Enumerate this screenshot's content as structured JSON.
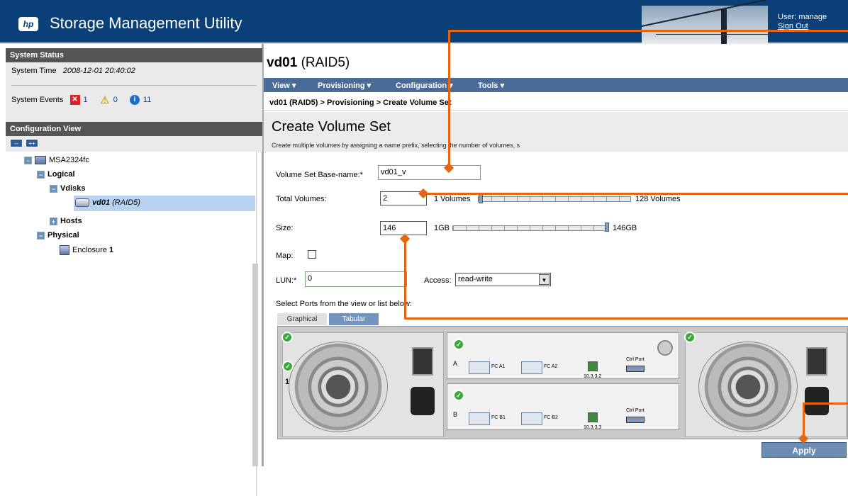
{
  "header": {
    "logo_text": "hp",
    "app_title": "Storage Management Utility",
    "user_label": "User: manage",
    "signout_label": "Sign Out"
  },
  "status": {
    "heading": "System Status",
    "time_label": "System Time",
    "time_value": "2008-12-01 20:40:02",
    "events_label": "System Events",
    "errors": "1",
    "warnings": "0",
    "info": "11"
  },
  "config": {
    "heading": "Configuration View",
    "collapse_label": "--",
    "expand_label": "++"
  },
  "tree": {
    "system": "MSA2324fc",
    "logical": "Logical",
    "vdisks": "Vdisks",
    "vdisk_name": "vd01",
    "vdisk_raid": "(RAID5)",
    "hosts": "Hosts",
    "physical": "Physical",
    "enclosure_label": "Enclosure",
    "enclosure_num": "1"
  },
  "main": {
    "title_name": "vd01",
    "title_raid": "(RAID5)",
    "menu": [
      "View ▾",
      "Provisioning ▾",
      "Configuration ▾",
      "Tools ▾"
    ],
    "breadcrumb": "vd01 (RAID5) > Provisioning > Create Volume Set",
    "page_title": "Create Volume Set",
    "description": "Create multiple volumes by assigning a name prefix, selecting the number of volumes, s",
    "form": {
      "basename_label": "Volume Set Base-name:*",
      "basename_value": "vd01_v",
      "total_label": "Total Volumes:",
      "total_value": "2",
      "total_min": "1 Volumes",
      "total_max": "128 Volumes",
      "size_label": "Size:",
      "size_value": "146",
      "size_min": "1GB",
      "size_max": "146GB",
      "map_label": "Map:",
      "lun_label": "LUN:*",
      "lun_value": "0",
      "access_label": "Access:",
      "access_value": "read-write",
      "ports_label": "Select Ports from the view or list below:"
    },
    "tabs": [
      "Graphical",
      "Tabular"
    ],
    "enclosure": {
      "id": "1",
      "ctrl_a": "A",
      "ctrl_b": "B",
      "port_a1": "FC A1",
      "port_a2": "FC A2",
      "port_b1": "FC B1",
      "port_b2": "FC B2",
      "ctl_port": "Ctrl Port",
      "net_a": "10.3.3.2",
      "net_b": "10.3.3.3"
    },
    "apply_label": "Apply"
  },
  "colors": {
    "brand": "#0b3f78",
    "menu": "#4a6b98",
    "callout": "#e8650f"
  }
}
